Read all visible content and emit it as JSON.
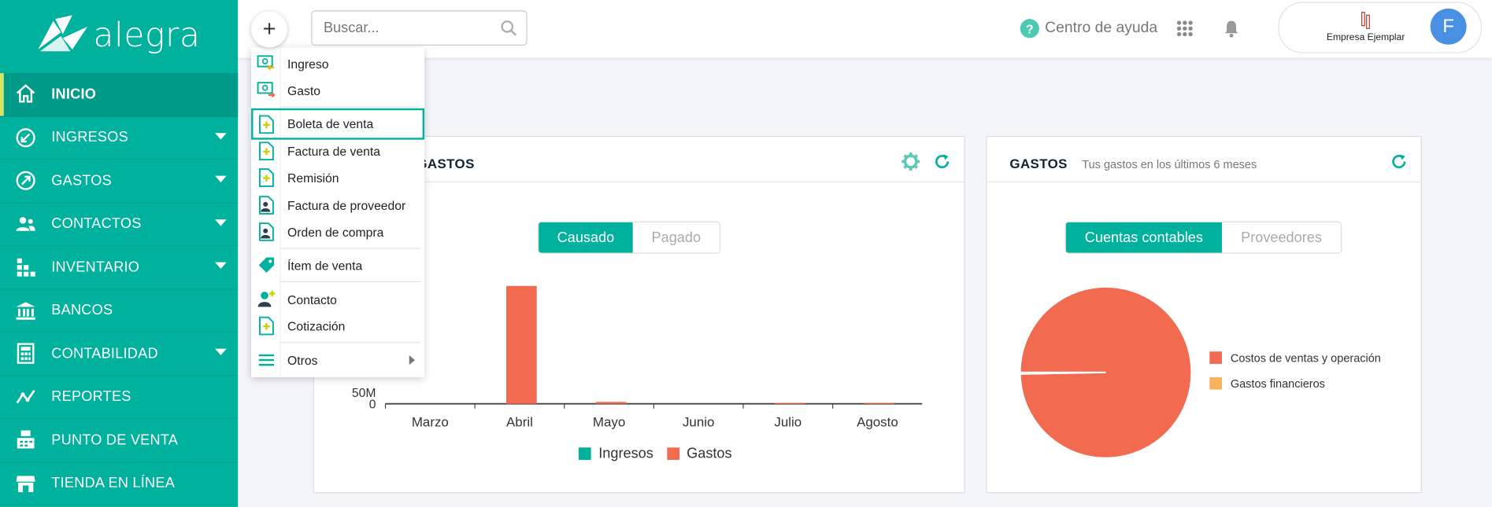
{
  "brand": {
    "name": "alegra"
  },
  "sidebar": {
    "items": [
      {
        "label": "INICIO",
        "icon": "home-icon",
        "active": true,
        "caret": false
      },
      {
        "label": "INGRESOS",
        "icon": "income-icon",
        "caret": true
      },
      {
        "label": "GASTOS",
        "icon": "expense-icon",
        "caret": true
      },
      {
        "label": "CONTACTOS",
        "icon": "contacts-icon",
        "caret": true
      },
      {
        "label": "INVENTARIO",
        "icon": "inventory-icon",
        "caret": true
      },
      {
        "label": "BANCOS",
        "icon": "bank-icon",
        "caret": false
      },
      {
        "label": "CONTABILIDAD",
        "icon": "accounting-icon",
        "caret": true
      },
      {
        "label": "REPORTES",
        "icon": "reports-icon",
        "caret": false
      },
      {
        "label": "PUNTO DE VENTA",
        "icon": "pos-icon",
        "caret": false
      },
      {
        "label": "TIENDA EN LÍNEA",
        "icon": "store-icon",
        "caret": false
      }
    ]
  },
  "topbar": {
    "plus_label": "+",
    "search_placeholder": "Buscar...",
    "help_label": "Centro de ayuda",
    "help_glyph": "?",
    "company_name": "Empresa Ejemplar",
    "avatar_letter": "F"
  },
  "quick_menu": {
    "items": [
      {
        "label": "Ingreso",
        "icon": "income-doc-icon"
      },
      {
        "label": "Gasto",
        "icon": "expense-doc-icon"
      },
      {
        "label": "Boleta de venta",
        "icon": "new-doc-icon",
        "highlight": true
      },
      {
        "label": "Factura de venta",
        "icon": "new-doc-icon"
      },
      {
        "label": "Remisión",
        "icon": "new-doc-icon"
      },
      {
        "label": "Factura de proveedor",
        "icon": "supplier-doc-icon"
      },
      {
        "label": "Orden de compra",
        "icon": "supplier-doc-icon"
      },
      {
        "label": "Ítem de venta",
        "icon": "tag-icon"
      },
      {
        "label": "Contacto",
        "icon": "add-contact-icon"
      },
      {
        "label": "Cotización",
        "icon": "new-doc-icon"
      },
      {
        "label": "Otros",
        "icon": "menu-lines-icon",
        "submenu": true
      }
    ]
  },
  "income_expense_card": {
    "title": "GASTOS",
    "toggle": [
      "Causado",
      "Pagado"
    ],
    "active_toggle": "Causado",
    "legend": [
      "Ingresos",
      "Gastos"
    ]
  },
  "expenses_card": {
    "title": "GASTOS",
    "subtitle": "Tus gastos en los últimos 6 meses",
    "toggle": [
      "Cuentas contables",
      "Proveedores"
    ],
    "active_toggle": "Cuentas contables"
  },
  "colors": {
    "brand": "#00b19d",
    "ingresos": "#00b19d",
    "gastos": "#f26b50",
    "gastos_financieros": "#f7b35b"
  },
  "chart_data": [
    {
      "type": "bar",
      "categories": [
        "Marzo",
        "Abril",
        "Mayo",
        "Junio",
        "Julio",
        "Agosto"
      ],
      "series": [
        {
          "name": "Ingresos",
          "values": [
            0,
            0,
            0,
            0,
            0,
            0
          ]
        },
        {
          "name": "Gastos",
          "values": [
            0,
            250,
            4,
            0,
            2,
            2
          ]
        }
      ],
      "y_ticks": [
        "0",
        "50M"
      ],
      "ylim": [
        0,
        260
      ],
      "legend": "bottom"
    },
    {
      "type": "pie",
      "labels": [
        "Costos de ventas y operación",
        "Gastos financieros"
      ],
      "values": [
        99.7,
        0.3
      ],
      "legend": "right"
    }
  ]
}
